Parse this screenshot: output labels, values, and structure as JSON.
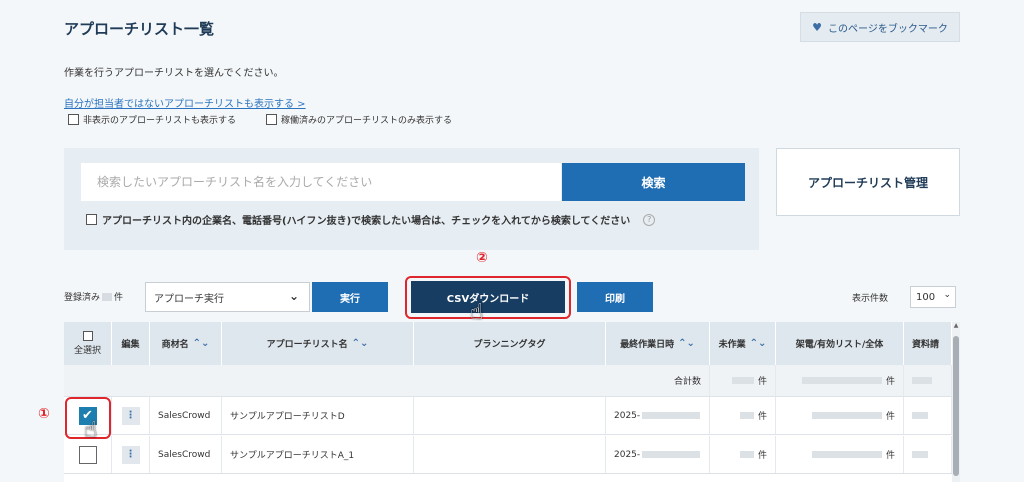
{
  "header": {
    "title": "アプローチリスト一覧",
    "bookmark_label": "このページをブックマーク"
  },
  "intro": {
    "instruction": "作業を行うアプローチリストを選んでください。",
    "toggle_link": "自分が担当者ではないアプローチリストも表示する >",
    "show_hidden_label": "非表示のアプローチリストも表示する",
    "show_active_only_label": "稼働済みのアプローチリストのみ表示する"
  },
  "search": {
    "placeholder": "検索したいアプローチリスト名を入力してください",
    "button_label": "検索",
    "company_search_label": "アプローチリスト内の企業名、電話番号(ハイフン抜き)で検索したい場合は、チェックを入れてから検索してください",
    "help_symbol": "?"
  },
  "manage_button": "アプローチリスト管理",
  "annotations": {
    "step1": "①",
    "step2": "②"
  },
  "actions": {
    "registered_prefix": "登録済み",
    "registered_suffix": "件",
    "action_select_value": "アプローチ実行",
    "execute_label": "実行",
    "csv_label": "CSVダウンロード",
    "print_label": "印刷",
    "per_page_label": "表示件数",
    "per_page_value": "100"
  },
  "table": {
    "headers": {
      "select_all": "全選択",
      "edit": "編集",
      "product": "商材名",
      "list_name": "アプローチリスト名",
      "planning_tag": "プランニングタグ",
      "last_work": "最終作業日時",
      "unworked": "未作業",
      "calls": "架電/有効リスト/全体",
      "materials": "資料請"
    },
    "total_label": "合計数",
    "unit": "件",
    "rows": [
      {
        "product": "SalesCrowd",
        "list_name": "サンプルアプローチリストD",
        "date_prefix": "2025-",
        "checked": true,
        "unit": "件"
      },
      {
        "product": "SalesCrowd",
        "list_name": "サンプルアプローチリストA_1",
        "date_prefix": "2025-",
        "checked": false,
        "unit": "件"
      }
    ]
  },
  "colors": {
    "primary_blue": "#1f6db3",
    "dark_blue": "#173d63",
    "annotation_red": "#e0262d",
    "header_bg": "#dfe7ee"
  },
  "icons": {
    "heart": "heart-icon",
    "chevron": "chevron-down-icon",
    "sort": "sort-icon",
    "edit": "kebab-icon",
    "hand": "hand-pointer-icon",
    "check": "checkmark-icon"
  }
}
